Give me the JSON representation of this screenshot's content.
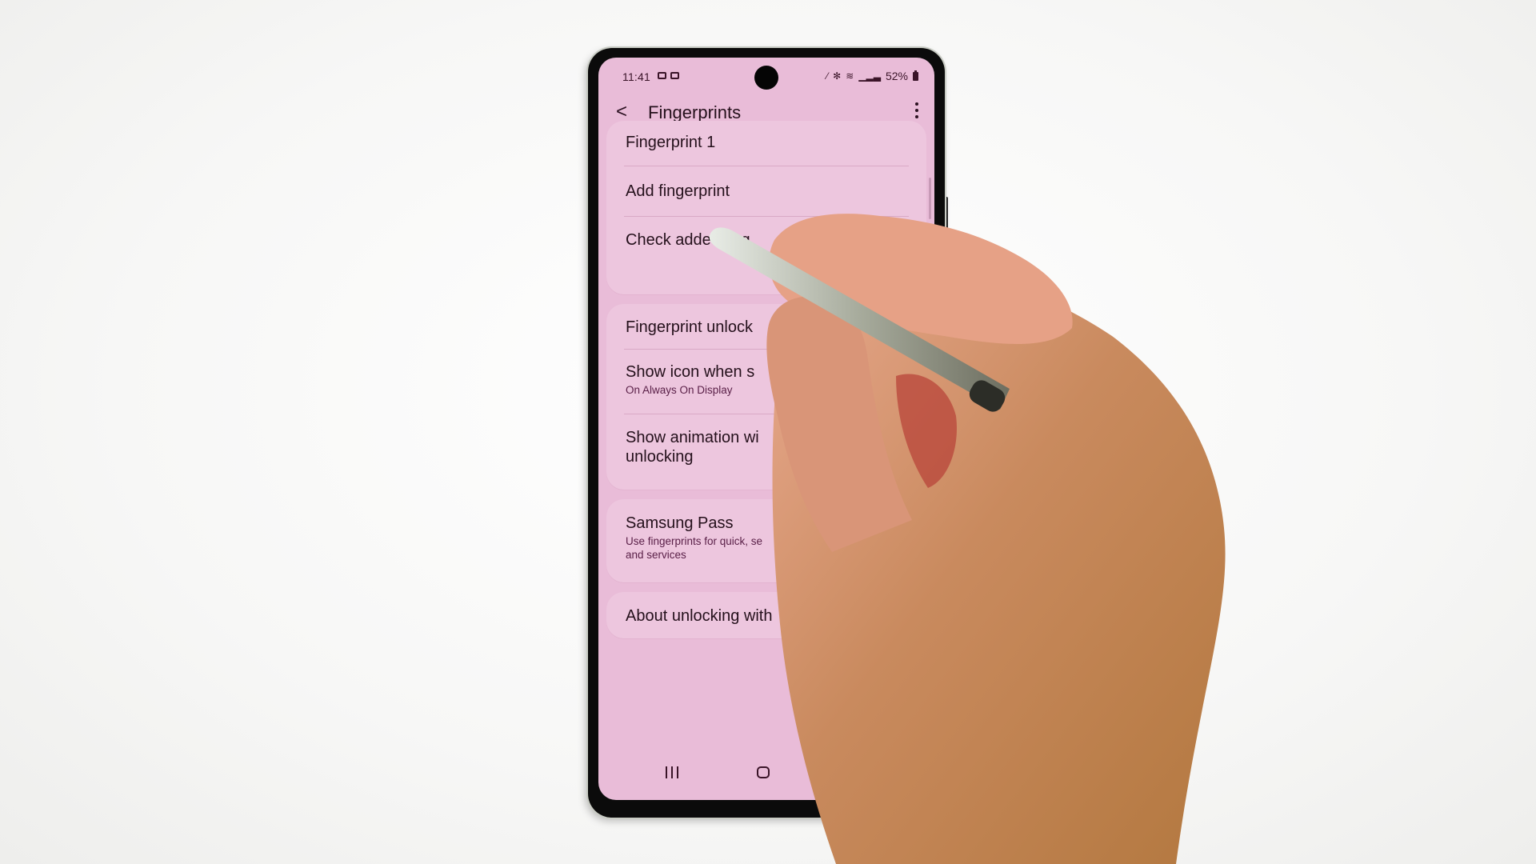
{
  "status_bar": {
    "time": "11:41",
    "notification_icons": [
      "gallery-notification-icon",
      "gallery-notification-icon"
    ],
    "right_icons": [
      "stylus-icon",
      "bluetooth-icon",
      "wifi-icon",
      "signal-icon"
    ],
    "battery": "52%"
  },
  "app_bar": {
    "back_icon": "chevron-left-icon",
    "title": "Fingerprints",
    "more_icon": "more-vertical-icon"
  },
  "sections": [
    {
      "items": [
        {
          "label": "Fingerprint 1"
        },
        {
          "label": "Add fingerprint"
        },
        {
          "label": "Check added fing"
        }
      ]
    },
    {
      "items": [
        {
          "label": "Fingerprint unlock"
        },
        {
          "label": "Show icon when s",
          "sub": "On Always On Display"
        },
        {
          "label": "Show animation wi",
          "label2": "unlocking"
        }
      ]
    },
    {
      "items": [
        {
          "label": "Samsung Pass",
          "sub": "Use fingerprints for quick, se",
          "sub2": "and services"
        }
      ]
    },
    {
      "items": [
        {
          "label": "About unlocking with"
        }
      ]
    }
  ],
  "nav_bar": {
    "recents_icon": "recents-icon",
    "home_icon": "home-icon"
  },
  "colors": {
    "screen_bg": "#e9bcd8",
    "card_bg": "#edc6de",
    "text_primary": "#24101b",
    "text_secondary": "#5a2048",
    "background": "#f7f7f6"
  }
}
